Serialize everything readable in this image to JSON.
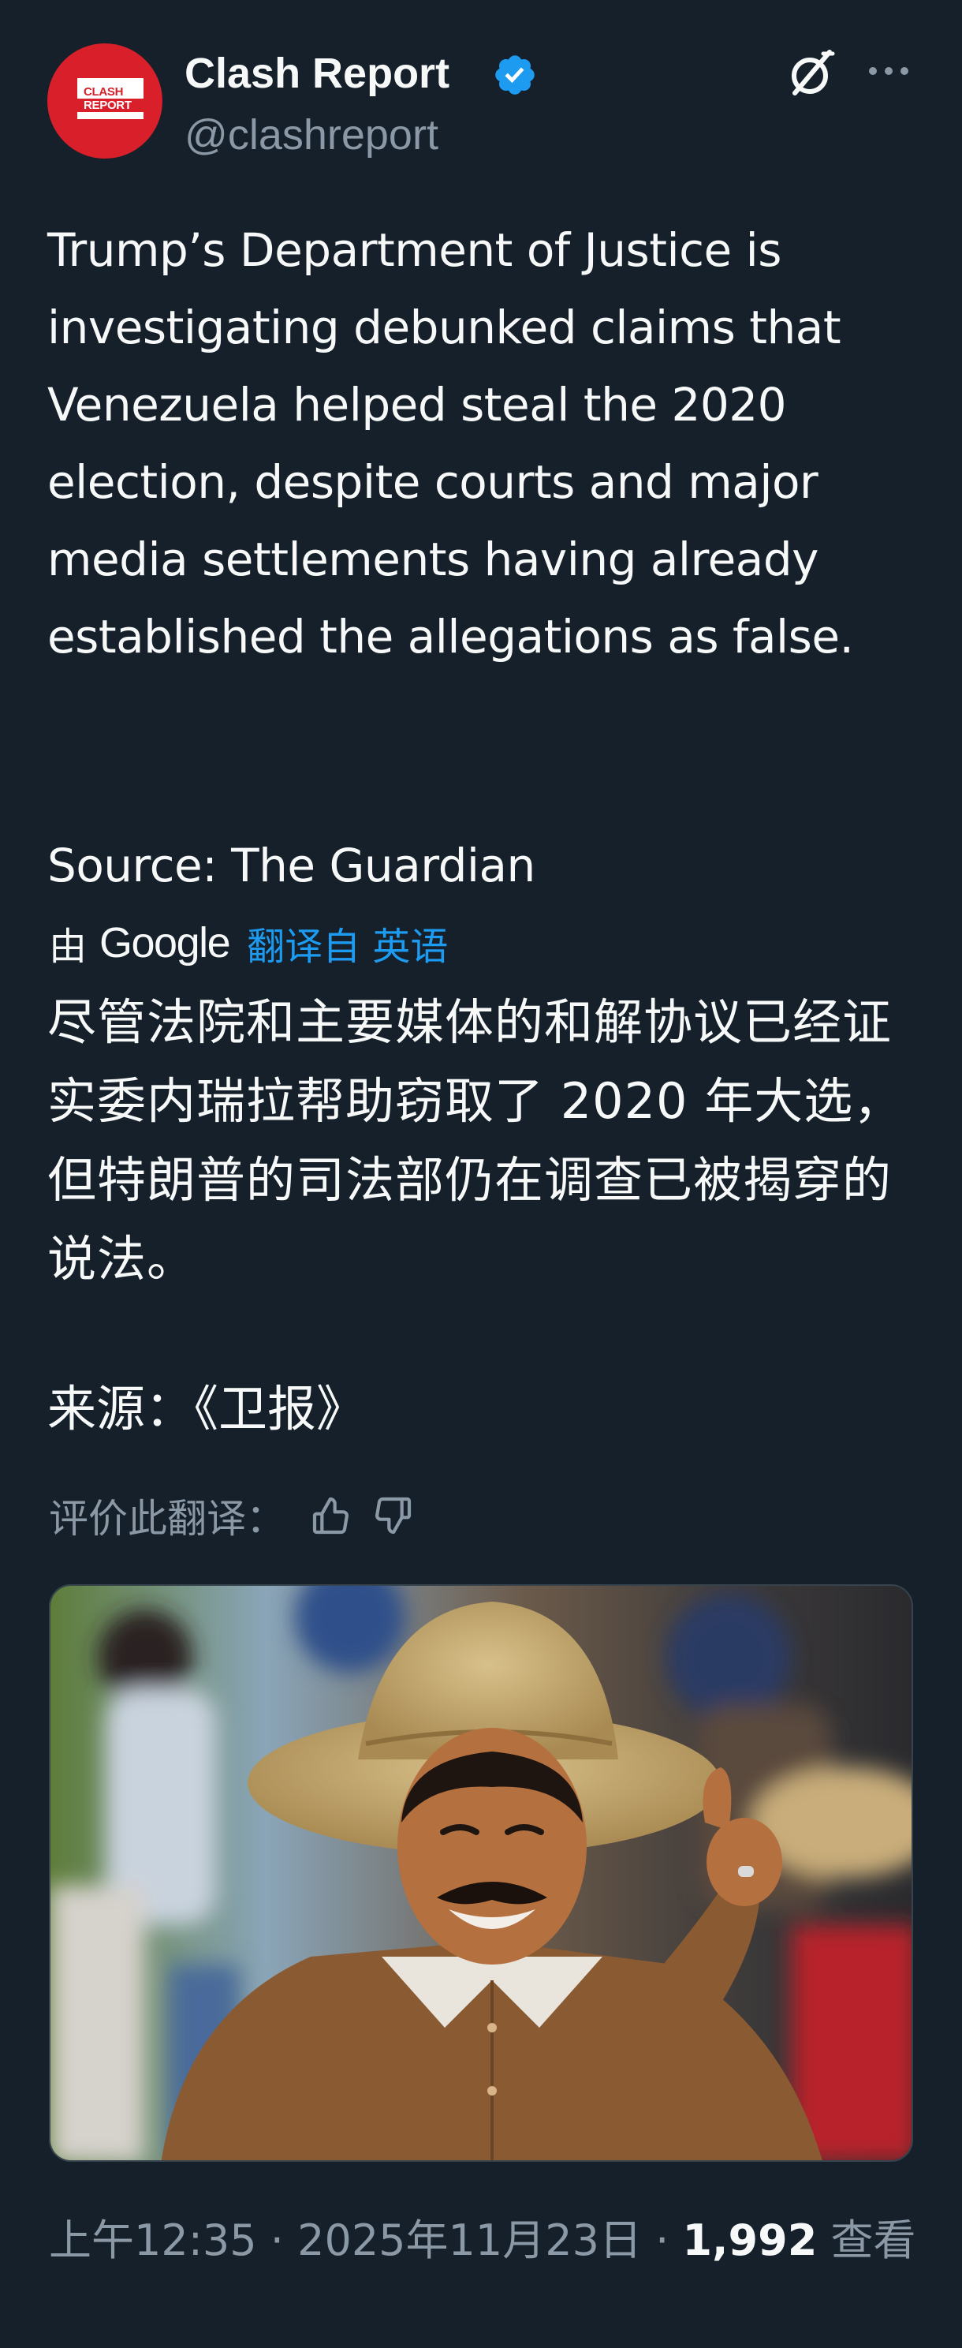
{
  "author": {
    "display_name": "Clash Report",
    "handle": "@clashreport",
    "avatar_logo_line1": "CLASH",
    "avatar_logo_line2": "REPORT",
    "verified": true
  },
  "header_icons": {
    "grok": "grok-icon",
    "more": "more-icon"
  },
  "tweet": {
    "text": "Trump’s Department of Justice is investigating debunked claims that Venezuela helped steal the 2020 election, despite courts and major media settlements having already established the allegations as false.",
    "source": "Source: The Guardian"
  },
  "translation": {
    "by_label": "由",
    "provider": "Google",
    "link_label": "翻译自 英语",
    "text": "尽管法院和主要媒体的和解协议已经证实委内瑞拉帮助窃取了 2020 年大选，但特朗普的司法部仍在调查已被揭穿的说法。",
    "source": "来源：《卫报》",
    "rate_label": "评价此翻译："
  },
  "media": {
    "type": "photo"
  },
  "meta": {
    "time_date": "上午12:35 · 2025年11月23日 · ",
    "views_count": "1,992",
    "views_label": " 查看"
  },
  "colors": {
    "background": "#15202b",
    "text": "#f7f9f9",
    "secondary": "#8b98a5",
    "accent": "#1d9bf0",
    "brand_red": "#d81f2a"
  }
}
